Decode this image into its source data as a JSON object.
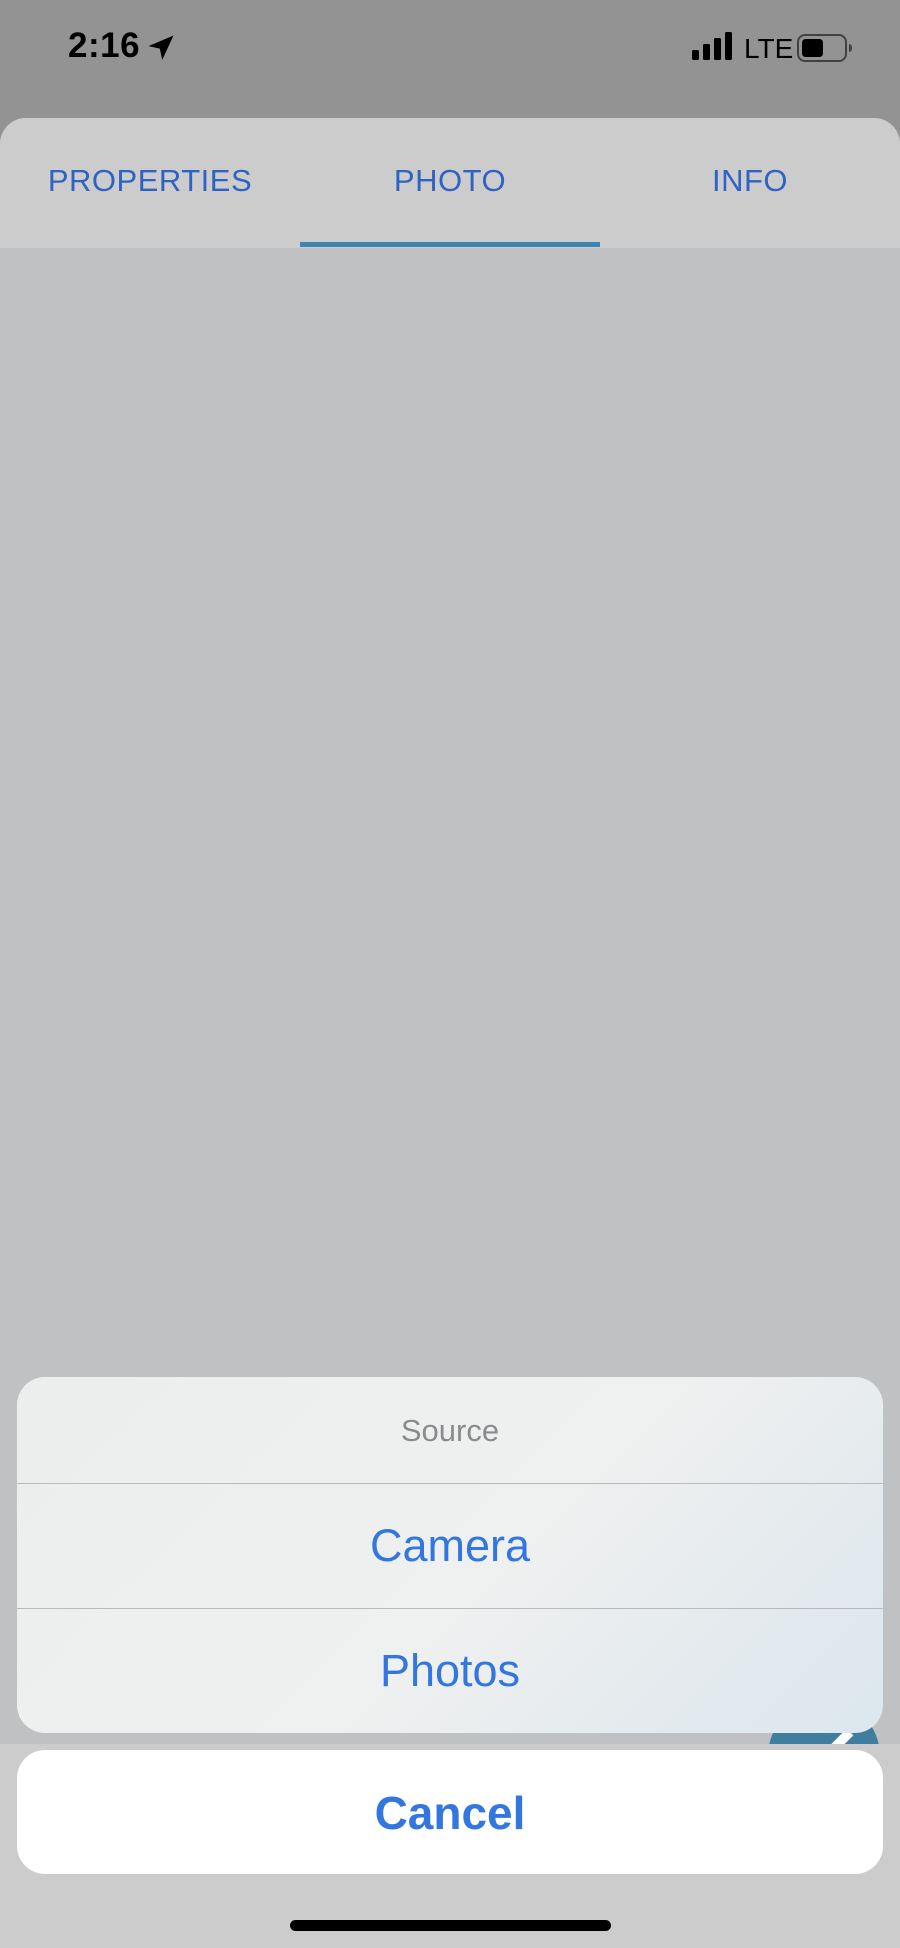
{
  "status_bar": {
    "time": "2:16",
    "network": "LTE",
    "location_icon": "location-arrow-icon",
    "signal_icon": "cellular-signal-icon",
    "battery_icon": "battery-icon"
  },
  "tabs": [
    {
      "label": "PROPERTIES",
      "selected": false
    },
    {
      "label": "PHOTO",
      "selected": true
    },
    {
      "label": "INFO",
      "selected": false
    }
  ],
  "action_sheet": {
    "title": "Source",
    "options": [
      {
        "label": "Camera"
      },
      {
        "label": "Photos"
      }
    ],
    "cancel_label": "Cancel"
  },
  "fab": {
    "icon": "pencil-icon"
  },
  "colors": {
    "accent": "#3476e0",
    "tab_text": "#2f62c4",
    "tab_indicator": "#3d86b3",
    "fab": "#3f7e9d"
  }
}
